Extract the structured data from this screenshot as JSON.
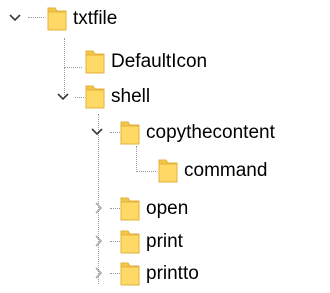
{
  "tree": {
    "nodes": [
      {
        "label": "txtfile",
        "state": "expanded"
      },
      {
        "label": "DefaultIcon",
        "state": "leaf"
      },
      {
        "label": "shell",
        "state": "expanded"
      },
      {
        "label": "copythecontent",
        "state": "expanded"
      },
      {
        "label": "command",
        "state": "leaf"
      },
      {
        "label": "open",
        "state": "collapsed"
      },
      {
        "label": "print",
        "state": "collapsed"
      },
      {
        "label": "printto",
        "state": "collapsed"
      }
    ]
  },
  "colors": {
    "folder_body": "#FFD966",
    "folder_tab": "#F3C64B",
    "folder_edge": "#E2B33A",
    "tree_line": "#9A9A9A",
    "chevron": "#3C3C3C",
    "chevron_collapsed": "#A8A8A8"
  }
}
